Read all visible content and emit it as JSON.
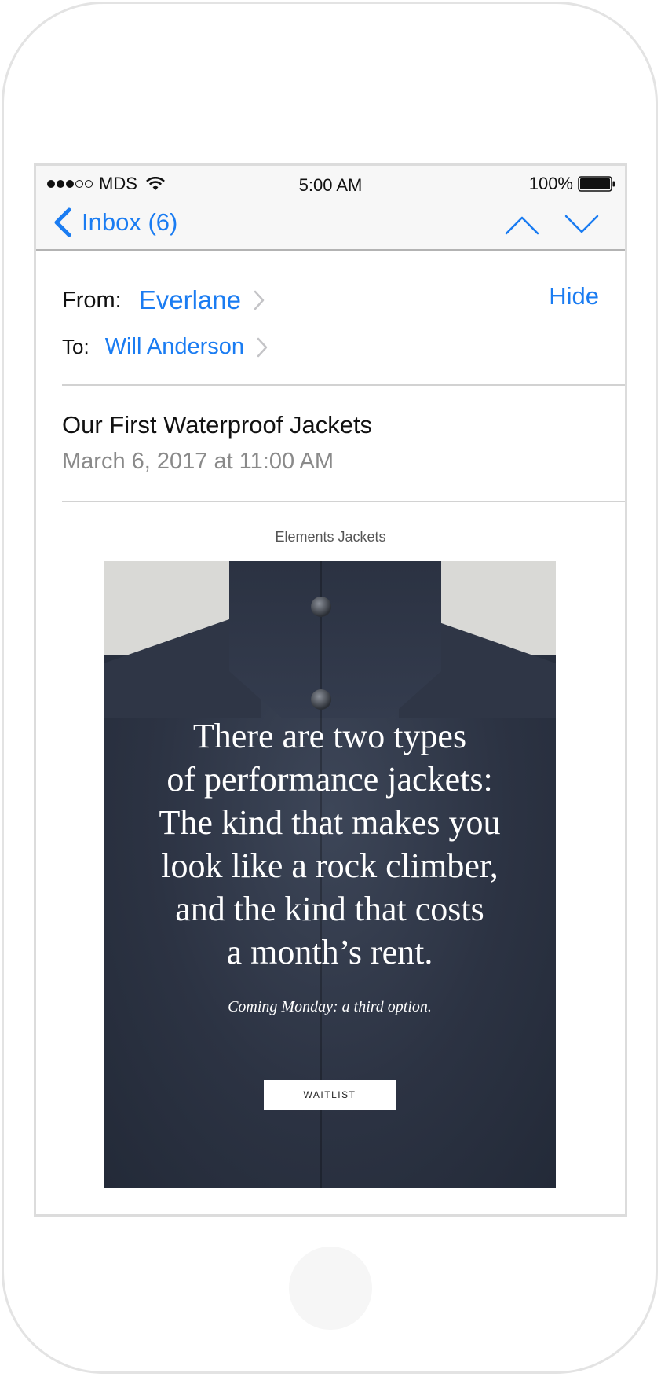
{
  "status_bar": {
    "carrier": "MDS",
    "signal_bars": 3,
    "signal_total": 5,
    "time": "5:00 AM",
    "battery": "100%",
    "battery_level": 1.0
  },
  "nav": {
    "back_label": "Inbox (6)",
    "back_icon": "chevron-left-icon",
    "up_icon": "chevron-up-icon",
    "down_icon": "chevron-down-icon"
  },
  "header": {
    "from_label": "From:",
    "from_value": "Everlane",
    "to_label": "To:",
    "to_value": "Will Anderson",
    "hide_label": "Hide"
  },
  "message": {
    "subject": "Our First Waterproof Jackets",
    "date": "March 6, 2017 at 11:00 AM"
  },
  "body": {
    "preheader": "Elements Jackets",
    "hero_quote": "There are two types\nof performance jackets:\nThe kind that makes you\nlook like a rock climber,\nand the kind that costs\na month’s rent.",
    "hero_tagline": "Coming Monday: a third option.",
    "cta_label": "WAITLIST"
  },
  "colors": {
    "accent": "#1a7cf2",
    "jacket": "#2c3343"
  }
}
